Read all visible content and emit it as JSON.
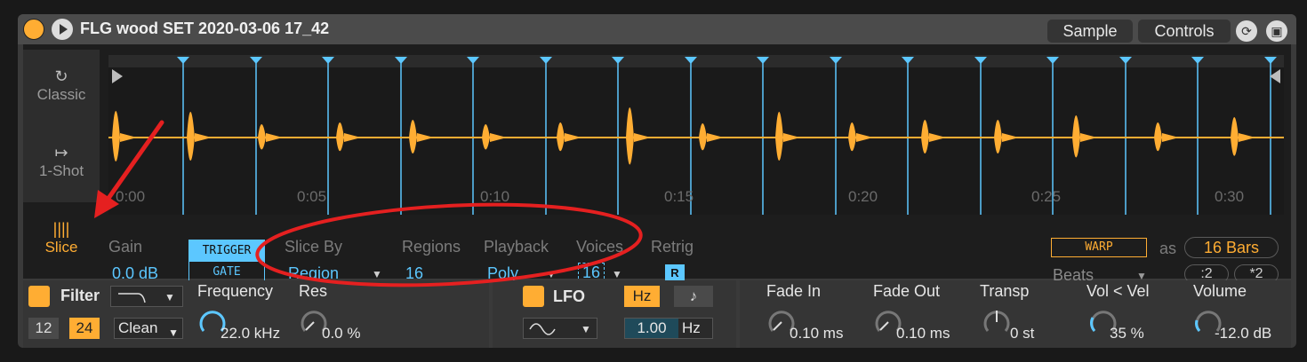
{
  "header": {
    "title": "FLG wood SET 2020-03-06 17_42",
    "tab_sample": "Sample",
    "tab_controls": "Controls"
  },
  "modes": [
    {
      "label": "Classic"
    },
    {
      "label": "1-Shot"
    },
    {
      "label": "Slice"
    }
  ],
  "waveform": {
    "time_labels": [
      "0:00",
      "0:05",
      "0:10",
      "0:15",
      "0:20",
      "0:25",
      "0:30"
    ],
    "slice_count": 16
  },
  "sample_params": {
    "gain_label": "Gain",
    "gain_value": "0.0 dB",
    "trigger": "TRIGGER",
    "gate": "GATE",
    "slice_by_label": "Slice By",
    "slice_by_value": "Region",
    "regions_label": "Regions",
    "regions_value": "16",
    "playback_label": "Playback",
    "playback_value": "Poly",
    "voices_label": "Voices",
    "voices_value": "16",
    "retrig_label": "Retrig",
    "retrig_value": "R",
    "warp": "WARP",
    "as_label": "as",
    "bars_value": "16 Bars",
    "beats_value": "Beats",
    "div2": ":2",
    "mul2": "*2"
  },
  "filter": {
    "label": "Filter",
    "btn12": "12",
    "btn24": "24",
    "type": "Clean",
    "freq_label": "Frequency",
    "freq_value": "22.0 kHz",
    "res_label": "Res",
    "res_value": "0.0 %"
  },
  "lfo": {
    "label": "LFO",
    "hz": "Hz",
    "note": "♪",
    "rate_num": "1.00",
    "rate_unit": "Hz"
  },
  "envelope": {
    "fade_in_label": "Fade In",
    "fade_in_value": "0.10 ms",
    "fade_out_label": "Fade Out",
    "fade_out_value": "0.10 ms",
    "transp_label": "Transp",
    "transp_value": "0 st",
    "volvel_label": "Vol < Vel",
    "volvel_value": "35 %",
    "volume_label": "Volume",
    "volume_value": "-12.0 dB"
  },
  "colors": {
    "accent": "#ffad33",
    "blue": "#5cc7ff",
    "annotation": "#e52020"
  }
}
